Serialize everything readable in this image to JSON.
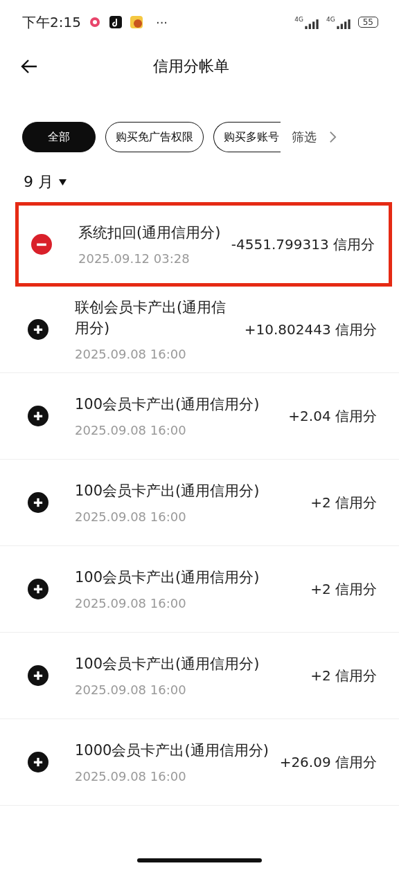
{
  "status_bar": {
    "time": "下午2:15",
    "more": "···",
    "network_1": "4G",
    "network_2": "4G",
    "battery": "55"
  },
  "header": {
    "title": "信用分帐单"
  },
  "filters": [
    {
      "label": "全部",
      "selected": true,
      "clipped": false
    },
    {
      "label": "购买免广告权限",
      "selected": false,
      "clipped": false
    },
    {
      "label": "购买多账号",
      "selected": false,
      "clipped": true
    }
  ],
  "filter_button": {
    "label": "筛选"
  },
  "month": {
    "label": "9 月"
  },
  "records": [
    {
      "kind": "minus",
      "highlighted": true,
      "title": "系统扣回(通用信用分)",
      "time": "2025.09.12 03:28",
      "amount": "-4551.799313 信用分"
    },
    {
      "kind": "plus",
      "highlighted": false,
      "title": "联创会员卡产出(通用信用分)",
      "time": "2025.09.08 16:00",
      "amount": "+10.802443 信用分"
    },
    {
      "kind": "plus",
      "highlighted": false,
      "title": "100会员卡产出(通用信用分)",
      "time": "2025.09.08 16:00",
      "amount": "+2.04 信用分"
    },
    {
      "kind": "plus",
      "highlighted": false,
      "title": "100会员卡产出(通用信用分)",
      "time": "2025.09.08 16:00",
      "amount": "+2 信用分"
    },
    {
      "kind": "plus",
      "highlighted": false,
      "title": "100会员卡产出(通用信用分)",
      "time": "2025.09.08 16:00",
      "amount": "+2 信用分"
    },
    {
      "kind": "plus",
      "highlighted": false,
      "title": "100会员卡产出(通用信用分)",
      "time": "2025.09.08 16:00",
      "amount": "+2 信用分"
    },
    {
      "kind": "plus",
      "highlighted": false,
      "title": "1000会员卡产出(通用信用分)",
      "time": "2025.09.08 16:00",
      "amount": "+26.09 信用分"
    }
  ]
}
